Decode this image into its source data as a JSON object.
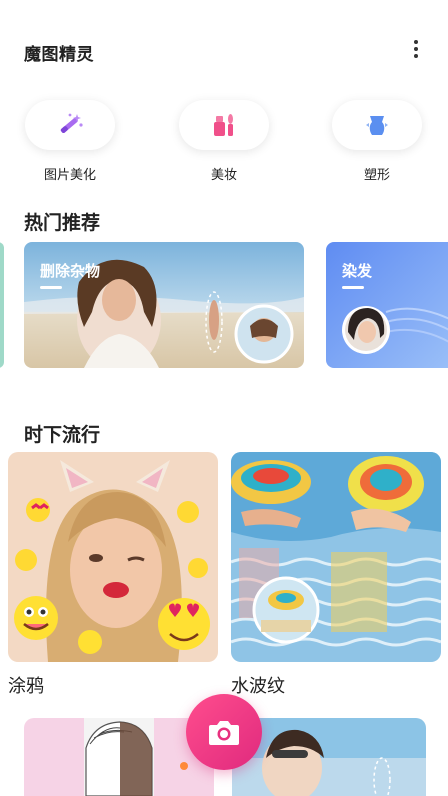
{
  "header": {
    "title": "魔图精灵",
    "more_icon": "more-vertical-icon"
  },
  "tools": [
    {
      "label": "图片美化",
      "icon": "magic-wand-icon",
      "color": "#a86bf0"
    },
    {
      "label": "美妆",
      "icon": "makeup-icon",
      "color": "#f0508a"
    },
    {
      "label": "塑形",
      "icon": "body-shape-icon",
      "color": "#5b8ff0"
    }
  ],
  "hot": {
    "title": "热门推荐",
    "cards": [
      {
        "caption": "删除杂物"
      },
      {
        "caption": "染发"
      }
    ]
  },
  "trending": {
    "title": "时下流行",
    "items": [
      {
        "label": "涂鸦"
      },
      {
        "label": "水波纹"
      }
    ]
  },
  "camera": {
    "icon": "camera-icon"
  },
  "colors": {
    "accent": "#e8317f",
    "hair_card": "#6f8ff5"
  }
}
